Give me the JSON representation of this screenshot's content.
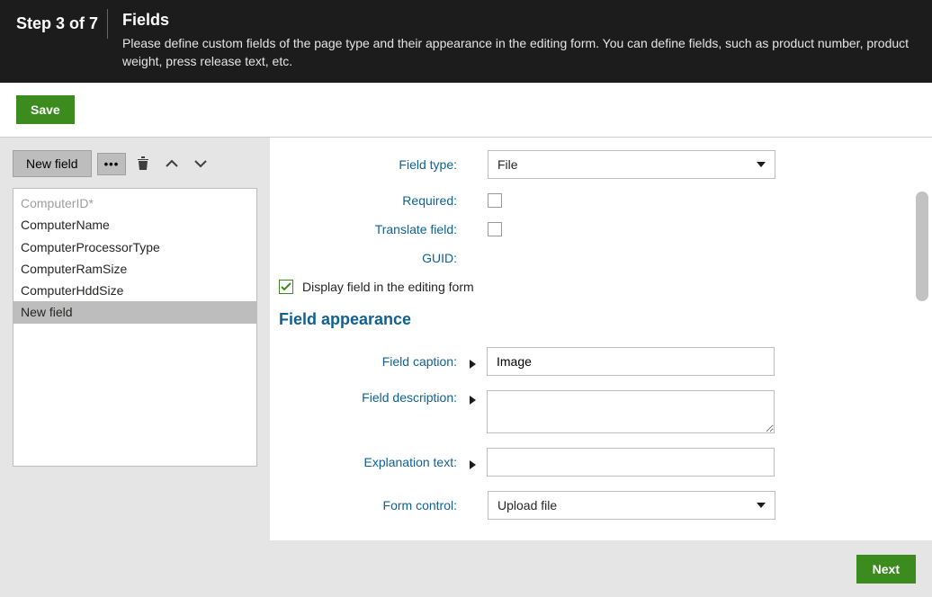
{
  "header": {
    "step": "Step 3 of 7",
    "title": "Fields",
    "subtitle": "Please define custom fields of the page type and their appearance in the editing form. You can define fields, such as product number, product weight, press release text, etc."
  },
  "actions": {
    "save_label": "Save",
    "next_label": "Next"
  },
  "sidebar": {
    "newfield_label": "New field",
    "more_label": "•••",
    "fields": [
      {
        "name": "ComputerID*",
        "disabled": true
      },
      {
        "name": "ComputerName",
        "disabled": false
      },
      {
        "name": "ComputerProcessorType",
        "disabled": false
      },
      {
        "name": "ComputerRamSize",
        "disabled": false
      },
      {
        "name": "ComputerHddSize",
        "disabled": false
      },
      {
        "name": "New field",
        "disabled": false,
        "selected": true
      }
    ]
  },
  "form": {
    "field_type": {
      "label": "Field type:",
      "value": "File"
    },
    "required": {
      "label": "Required:",
      "checked": false
    },
    "translate": {
      "label": "Translate field:",
      "checked": false
    },
    "guid": {
      "label": "GUID:",
      "value": ""
    },
    "display_field_checkbox": {
      "label": "Display field in the editing form",
      "checked": true
    },
    "appearance_heading": "Field appearance",
    "field_caption": {
      "label": "Field caption:",
      "value": "Image"
    },
    "field_description": {
      "label": "Field description:",
      "value": ""
    },
    "explanation_text": {
      "label": "Explanation text:",
      "value": ""
    },
    "form_control": {
      "label": "Form control:",
      "value": "Upload file"
    }
  }
}
